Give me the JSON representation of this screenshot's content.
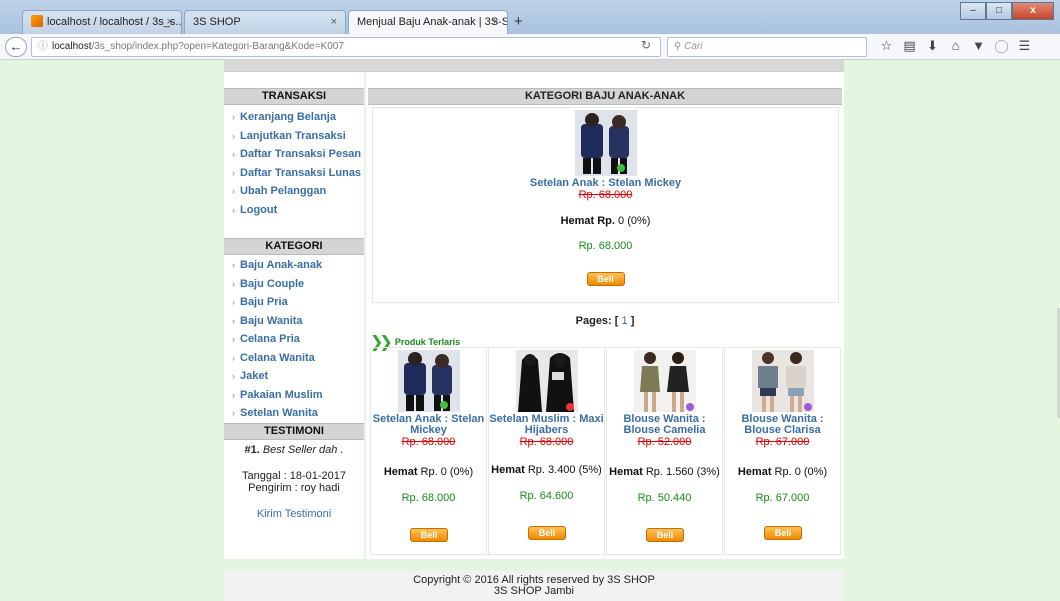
{
  "browser": {
    "tabs": [
      {
        "title": "localhost / localhost / 3s_s...",
        "close": "×"
      },
      {
        "title": "3S SHOP",
        "close": "×"
      },
      {
        "title": "Menjual Baju Anak-anak | 3S-S...",
        "close": "×"
      }
    ],
    "new_tab": "+",
    "url_prefix": "localhost",
    "url_rest": "/3s_shop/index.php?open=Kategori-Barang&Kode=K007",
    "search_placeholder": "Cari",
    "window_buttons": {
      "minimize": "–",
      "maximize": "□",
      "close": "x"
    }
  },
  "sidebar": {
    "transaksi_title": "TRANSAKSI",
    "transaksi_items": [
      "Keranjang Belanja",
      "Lanjutkan Transaksi",
      "Daftar Transaksi Pesan",
      "Daftar Transaksi Lunas",
      "Ubah Pelanggan",
      "Logout"
    ],
    "kategori_title": "KATEGORI",
    "kategori_items": [
      "Baju Anak-anak",
      "Baju Couple",
      "Baju Pria",
      "Baju Wanita",
      "Celana Pria",
      "Celana Wanita",
      "Jaket",
      "Pakaian Muslim",
      "Setelan Wanita"
    ],
    "testimoni_title": "TESTIMONI",
    "testimoni_number": "#1.",
    "testimoni_quote": "Best Seller dah .",
    "testimoni_tanggal": "Tanggal : 18-01-2017",
    "testimoni_pengirim": "Pengirim : roy hadi",
    "kirim_testimoni": "Kirim Testimoni"
  },
  "main": {
    "header": "KATEGORI BAJU ANAK-ANAK",
    "featured": {
      "name": "Setelan Anak : Stelan Mickey",
      "old_price": "Rp. 68.000",
      "hemat_label": "Hemat Rp.",
      "hemat_value": "0 (0%)",
      "new_price": "Rp. 68.000",
      "buy": "Beli"
    },
    "pages_label": "Pages: [",
    "pages_current": "1",
    "pages_close": "]",
    "terlaris_title": "Produk Terlaris",
    "products": [
      {
        "name": "Setelan Anak : Stelan Mickey",
        "old_price": "Rp. 68.000",
        "hemat_label": "Hemat",
        "hemat_value": "Rp. 0 (0%)",
        "new_price": "Rp. 68.000",
        "buy": "Beli"
      },
      {
        "name": "Setelan Muslim : Maxi Hijabers",
        "old_price": "Rp. 68.000",
        "hemat_label": "Hemat",
        "hemat_value": "Rp. 3.400 (5%)",
        "new_price": "Rp. 64.600",
        "buy": "Beli"
      },
      {
        "name": "Blouse Wanita : Blouse Camelia",
        "old_price": "Rp. 52.000",
        "hemat_label": "Hemat",
        "hemat_value": "Rp. 1.560 (3%)",
        "new_price": "Rp. 50.440",
        "buy": "Beli"
      },
      {
        "name": "Blouse Wanita : Blouse Clarisa",
        "old_price": "Rp. 67.000",
        "hemat_label": "Hemat",
        "hemat_value": "Rp. 0 (0%)",
        "new_price": "Rp. 67.000",
        "buy": "Beli"
      }
    ]
  },
  "footer": {
    "copyright": "Copyright © 2016 All rights reserved by 3S SHOP",
    "location": "3S SHOP Jambi"
  }
}
